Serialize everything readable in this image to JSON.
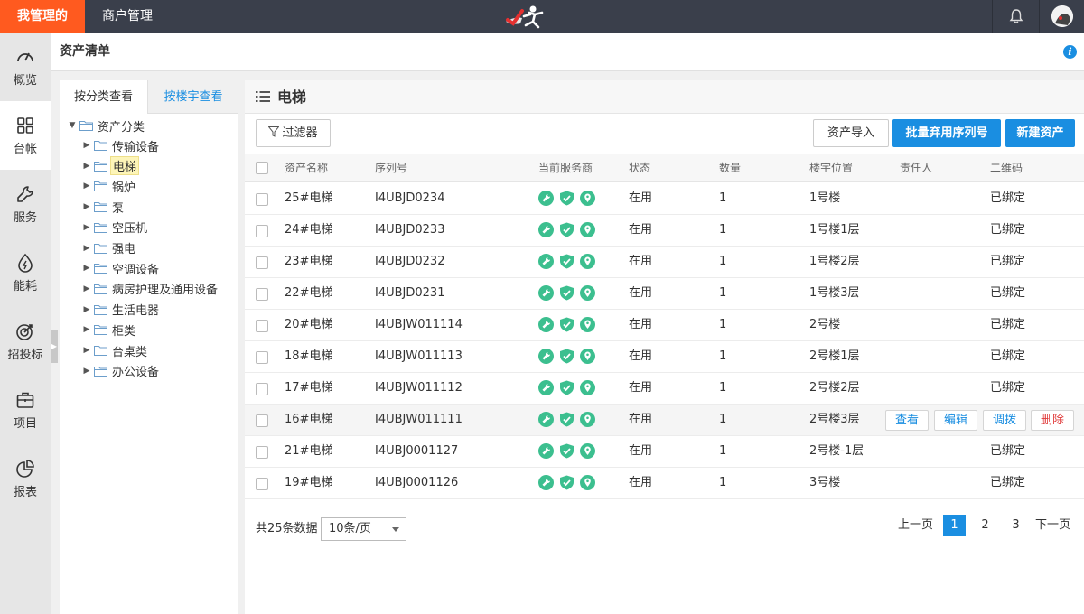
{
  "topbar": {
    "tabs": [
      "我管理的",
      "商户管理"
    ]
  },
  "sidebar": {
    "items": [
      "概览",
      "台帐",
      "服务",
      "能耗",
      "招投标",
      "项目",
      "报表"
    ],
    "active": "台帐"
  },
  "page": {
    "title": "资产清单"
  },
  "tree": {
    "tabs": [
      "按分类查看",
      "按楼宇查看"
    ],
    "root": "资产分类",
    "nodes": [
      "传输设备",
      "电梯",
      "锅炉",
      "泵",
      "空压机",
      "强电",
      "空调设备",
      "病房护理及通用设备",
      "生活电器",
      "柜类",
      "台桌类",
      "办公设备"
    ],
    "selected": "电梯"
  },
  "main": {
    "title": "电梯",
    "filter_label": "过滤器",
    "import_label": "资产导入",
    "batch_label": "批量弃用序列号",
    "new_label": "新建资产"
  },
  "table": {
    "headers": [
      "资产名称",
      "序列号",
      "当前服务商",
      "状态",
      "数量",
      "楼宇位置",
      "责任人",
      "二维码"
    ],
    "rows": [
      {
        "name": "25#电梯",
        "serial": "I4UBJD0234",
        "status": "在用",
        "qty": "1",
        "location": "1号楼",
        "owner": "",
        "qr": "已绑定"
      },
      {
        "name": "24#电梯",
        "serial": "I4UBJD0233",
        "status": "在用",
        "qty": "1",
        "location": "1号楼1层",
        "owner": "",
        "qr": "已绑定"
      },
      {
        "name": "23#电梯",
        "serial": "I4UBJD0232",
        "status": "在用",
        "qty": "1",
        "location": "1号楼2层",
        "owner": "",
        "qr": "已绑定"
      },
      {
        "name": "22#电梯",
        "serial": "I4UBJD0231",
        "status": "在用",
        "qty": "1",
        "location": "1号楼3层",
        "owner": "",
        "qr": "已绑定"
      },
      {
        "name": "20#电梯",
        "serial": "I4UBJW011114",
        "status": "在用",
        "qty": "1",
        "location": "2号楼",
        "owner": "",
        "qr": "已绑定"
      },
      {
        "name": "18#电梯",
        "serial": "I4UBJW011113",
        "status": "在用",
        "qty": "1",
        "location": "2号楼1层",
        "owner": "",
        "qr": "已绑定"
      },
      {
        "name": "17#电梯",
        "serial": "I4UBJW011112",
        "status": "在用",
        "qty": "1",
        "location": "2号楼2层",
        "owner": "",
        "qr": "已绑定"
      },
      {
        "name": "16#电梯",
        "serial": "I4UBJW011111",
        "status": "在用",
        "qty": "1",
        "location": "2号楼3层",
        "owner": "",
        "qr": ""
      },
      {
        "name": "21#电梯",
        "serial": "I4UBJ0001127",
        "status": "在用",
        "qty": "1",
        "location": "2号楼-1层",
        "owner": "",
        "qr": "已绑定"
      },
      {
        "name": "19#电梯",
        "serial": "I4UBJ0001126",
        "status": "在用",
        "qty": "1",
        "location": "3号楼",
        "owner": "",
        "qr": "已绑定"
      }
    ],
    "row_actions": [
      "查看",
      "编辑",
      "调拨",
      "删除"
    ]
  },
  "pagination": {
    "total": "共25条数据",
    "page_size": "10条/页",
    "prev": "上一页",
    "pages": [
      "1",
      "2",
      "3"
    ],
    "next": "下一页",
    "current": "1"
  },
  "colors": {
    "accent": "#1a8ee1",
    "brand": "#ff5a1f",
    "topbar": "#3a3f4b",
    "service_icon": "#3cbf8f",
    "danger": "#e03a3a"
  },
  "icons": {
    "service": [
      "wrench-icon",
      "shield-check-icon",
      "location-pin-icon"
    ]
  }
}
